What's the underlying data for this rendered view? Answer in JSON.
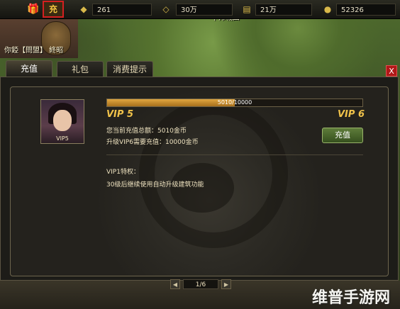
{
  "topbar": {
    "gift_icon": "gift-icon",
    "charge_label": "充",
    "resources": [
      {
        "icon": "gold-ingot-icon",
        "value": "261"
      },
      {
        "icon": "silver-icon",
        "value": "30万"
      },
      {
        "icon": "scroll-icon",
        "value": "21万"
      },
      {
        "icon": "coin-icon",
        "value": "52326"
      }
    ]
  },
  "map": {
    "location_label": "下沛城四",
    "city_name": "你錏【問盟】 終昭"
  },
  "tabs": [
    "充值",
    "礼包",
    "消费提示"
  ],
  "close_label": "X",
  "vip": {
    "portrait_label": "VIP5",
    "progress": {
      "current": 5010,
      "max": 10000,
      "text": "5010/10000"
    },
    "current_level": "VIP 5",
    "next_level": "VIP 6",
    "total_recharge": "您当前充值总额：5010金币",
    "upgrade_need": "升级VIP6需要充值：10000金币",
    "recharge_button": "充值",
    "privilege_title": "VIP1特权：",
    "privilege_desc": "30级后继续使用自动升级建筑功能"
  },
  "pager": {
    "prev": "◀",
    "text": "1/6",
    "next": "▶"
  },
  "watermark": "维普手游网",
  "colors": {
    "accent": "#f0c24a",
    "close": "#b01818",
    "button": "#4e6c2e"
  }
}
